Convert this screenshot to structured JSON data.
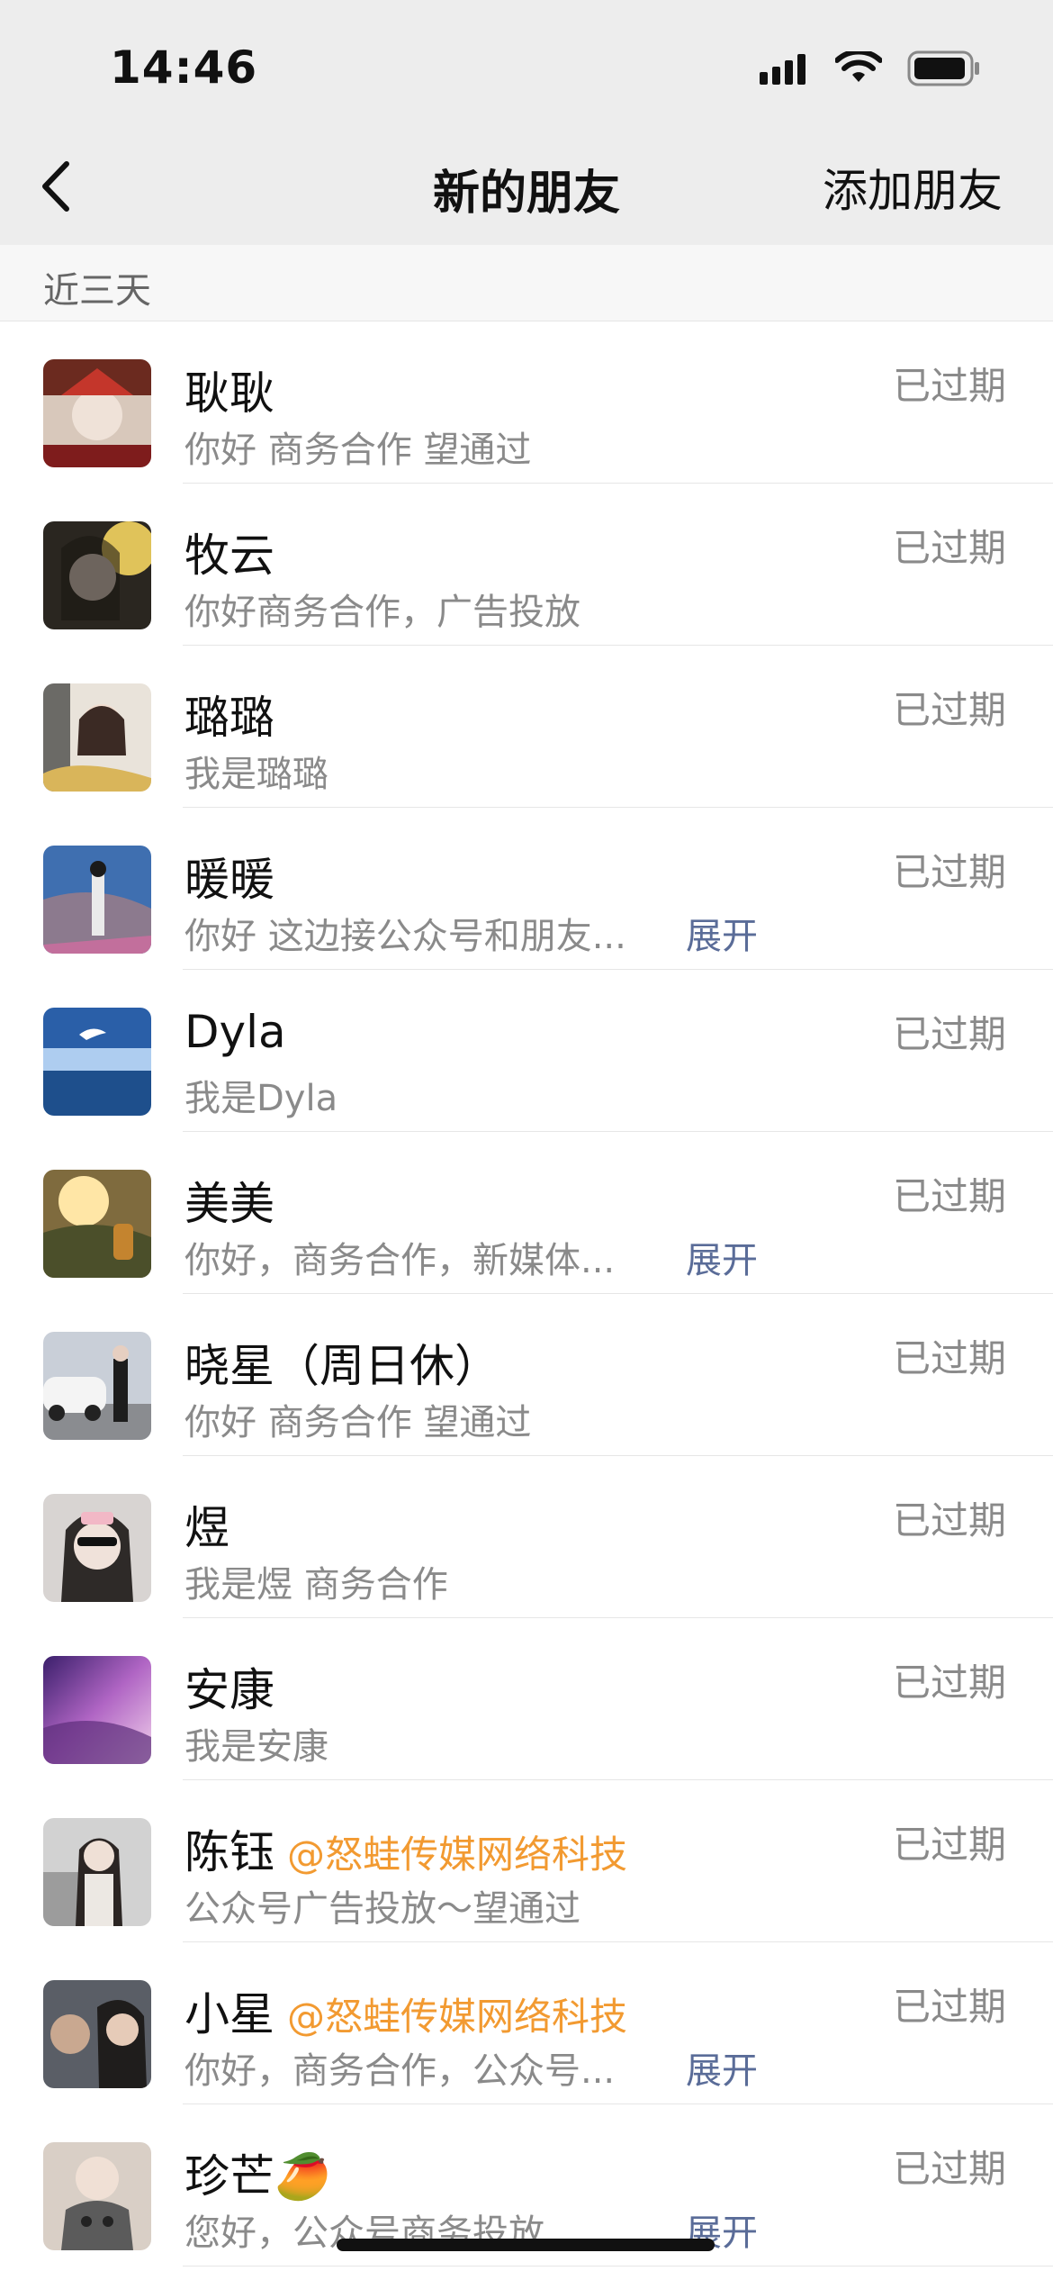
{
  "status_bar": {
    "time": "14:46"
  },
  "nav": {
    "title": "新的朋友",
    "add_label": "添加朋友"
  },
  "section": {
    "label": "近三天"
  },
  "requests": [
    {
      "name": "耿耿",
      "tag": "",
      "message": "你好 商务合作 望通过",
      "expand": "",
      "status": "已过期"
    },
    {
      "name": "牧云",
      "tag": "",
      "message": "你好商务合作，广告投放",
      "expand": "",
      "status": "已过期"
    },
    {
      "name": "璐璐",
      "tag": "",
      "message": "我是璐璐",
      "expand": "",
      "status": "已过期"
    },
    {
      "name": "暖暖",
      "tag": "",
      "message": "你好 这边接公众号和朋友...",
      "expand": "展开",
      "status": "已过期"
    },
    {
      "name": "Dyla",
      "tag": "",
      "message": "我是Dyla",
      "expand": "",
      "status": "已过期"
    },
    {
      "name": "美美",
      "tag": "",
      "message": "你好，商务合作，新媒体...",
      "expand": "展开",
      "status": "已过期"
    },
    {
      "name": "晓星（周日休）",
      "tag": "",
      "message": "你好 商务合作 望通过",
      "expand": "",
      "status": "已过期"
    },
    {
      "name": "煜",
      "tag": "",
      "message": "我是煜 商务合作",
      "expand": "",
      "status": "已过期"
    },
    {
      "name": "安康",
      "tag": "",
      "message": "我是安康",
      "expand": "",
      "status": "已过期"
    },
    {
      "name": "陈钰",
      "tag": "@怒蛙传媒网络科技",
      "message": "公众号广告投放～望通过",
      "expand": "",
      "status": "已过期"
    },
    {
      "name": "小星",
      "tag": "@怒蛙传媒网络科技",
      "message": "你好，商务合作，公众号...",
      "expand": "展开",
      "status": "已过期"
    },
    {
      "name": "珍芒🥭",
      "tag": "",
      "message": "您好，公众号商务投放...",
      "expand": "展开",
      "status": "已过期"
    }
  ],
  "colors": {
    "nav_bg": "#ededed",
    "tag": "#f29a31",
    "expand_link": "#5a6c98",
    "secondary_text": "#8a8a8a"
  }
}
